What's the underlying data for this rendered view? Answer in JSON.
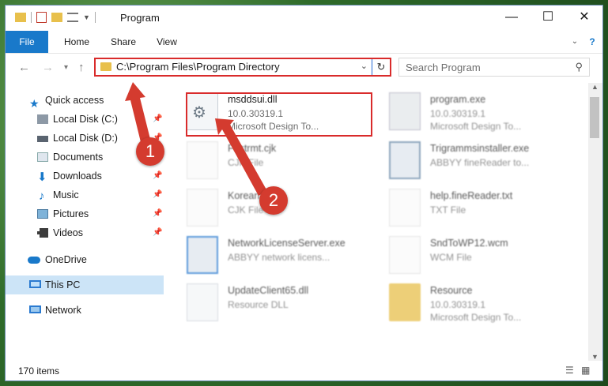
{
  "window": {
    "title": "Program"
  },
  "ribbon": {
    "tabs": [
      "File",
      "Home",
      "Share",
      "View"
    ]
  },
  "address": {
    "path": "C:\\Program Files\\Program Directory"
  },
  "search": {
    "placeholder": "Search Program"
  },
  "sidebar": {
    "items": [
      {
        "label": "Quick access",
        "icon": "star-icon",
        "pinned": false
      },
      {
        "label": "Local Disk (C:)",
        "icon": "drive-icon",
        "pinned": true
      },
      {
        "label": "Local Disk (D:)",
        "icon": "drive-icon",
        "pinned": true
      },
      {
        "label": "Documents",
        "icon": "documents-icon",
        "pinned": true
      },
      {
        "label": "Downloads",
        "icon": "download-icon",
        "pinned": true
      },
      {
        "label": "Music",
        "icon": "music-icon",
        "pinned": true
      },
      {
        "label": "Pictures",
        "icon": "pictures-icon",
        "pinned": true
      },
      {
        "label": "Videos",
        "icon": "videos-icon",
        "pinned": true
      },
      {
        "label": "OneDrive",
        "icon": "cloud-icon",
        "pinned": false
      },
      {
        "label": "This PC",
        "icon": "computer-icon",
        "pinned": false,
        "selected": true
      },
      {
        "label": "Network",
        "icon": "network-icon",
        "pinned": false
      }
    ]
  },
  "files": [
    {
      "name": "msddsui.dll",
      "line2": "10.0.30319.1",
      "line3": "Microsoft Design To...",
      "highlighted": true
    },
    {
      "name": "program.exe",
      "line2": "10.0.30319.1",
      "line3": "Microsoft Design To..."
    },
    {
      "name": "Fastrmt.cjk",
      "line2": "CJK File"
    },
    {
      "name": "Trigrammsinstaller.exe",
      "line2": "ABBYY fineReader to..."
    },
    {
      "name": "Korean.cjk",
      "line2": "CJK File"
    },
    {
      "name": "help.fineReader.txt",
      "line2": "TXT File"
    },
    {
      "name": "NetworkLicenseServer.exe",
      "line2": "ABBYY network licens..."
    },
    {
      "name": "SndToWP12.wcm",
      "line2": "WCM File"
    },
    {
      "name": "UpdateClient65.dll",
      "line2": "Resource DLL"
    },
    {
      "name": "Resource",
      "line2": "10.0.30319.1",
      "line3": "Microsoft Design To..."
    }
  ],
  "status": {
    "item_count": "170 items"
  },
  "callouts": [
    "1",
    "2"
  ]
}
